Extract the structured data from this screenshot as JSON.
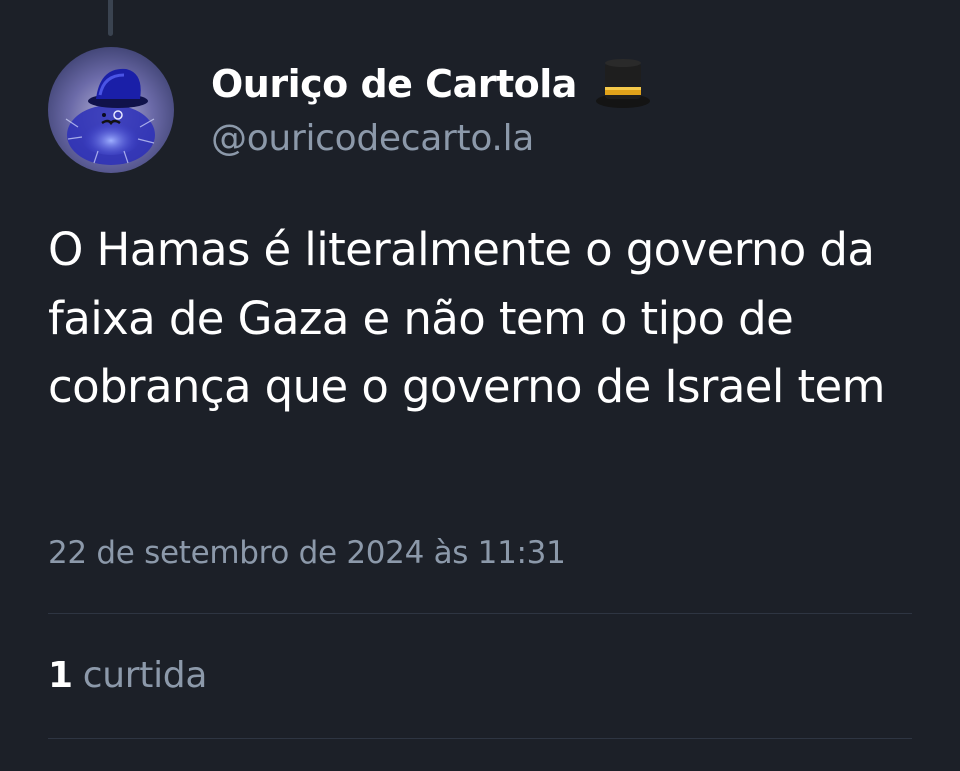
{
  "post": {
    "author": {
      "display_name": "Ouriço de Cartola",
      "name_emoji": "top-hat-emoji",
      "handle": "@ouricodecarto.la",
      "avatar_icon": "hedgehog-top-hat-avatar"
    },
    "text": "O Hamas é literalmente o governo da faixa de Gaza e não tem o tipo de cobrança que o governo de Israel tem",
    "timestamp": "22 de setembro de 2024 às 11:31",
    "likes": {
      "count": "1",
      "label": "curtida"
    }
  },
  "colors": {
    "background": "#1c2028",
    "primary_text": "#ffffff",
    "secondary_text": "#8c99aa",
    "divider": "#2e3542"
  }
}
